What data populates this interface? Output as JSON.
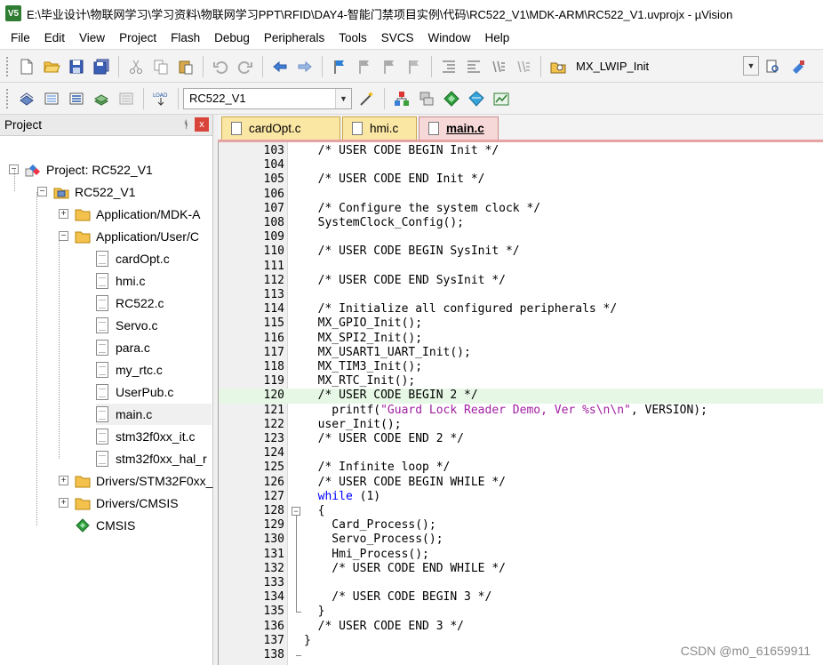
{
  "window": {
    "app_icon": "V5",
    "title": "E:\\毕业设计\\物联网学习\\学习资料\\物联网学习PPT\\RFID\\DAY4-智能门禁项目实例\\代码\\RC522_V1\\MDK-ARM\\RC522_V1.uvprojx - µVision"
  },
  "menu": [
    "File",
    "Edit",
    "View",
    "Project",
    "Flash",
    "Debug",
    "Peripherals",
    "Tools",
    "SVCS",
    "Window",
    "Help"
  ],
  "toolbar1": {
    "target_label": "MX_LWIP_Init"
  },
  "toolbar2": {
    "target_select": "RC522_V1"
  },
  "project_panel": {
    "title": "Project",
    "pin": "ᚬ",
    "close": "x",
    "tree": [
      {
        "label": "Project: RC522_V1",
        "icon": "project-icon",
        "level": 0,
        "expander": "−"
      },
      {
        "label": "RC522_V1",
        "icon": "target-icon",
        "level": 1,
        "expander": "−"
      },
      {
        "label": "Application/MDK-A",
        "icon": "folder-icon",
        "level": 2,
        "expander": "+"
      },
      {
        "label": "Application/User/C",
        "icon": "folder-icon",
        "level": 2,
        "expander": "−"
      },
      {
        "label": "cardOpt.c",
        "icon": "file-icon",
        "level": 3,
        "expander": ""
      },
      {
        "label": "hmi.c",
        "icon": "file-icon",
        "level": 3,
        "expander": ""
      },
      {
        "label": "RC522.c",
        "icon": "file-icon",
        "level": 3,
        "expander": ""
      },
      {
        "label": "Servo.c",
        "icon": "file-icon",
        "level": 3,
        "expander": ""
      },
      {
        "label": "para.c",
        "icon": "file-icon",
        "level": 3,
        "expander": ""
      },
      {
        "label": "my_rtc.c",
        "icon": "file-icon",
        "level": 3,
        "expander": ""
      },
      {
        "label": "UserPub.c",
        "icon": "file-icon",
        "level": 3,
        "expander": ""
      },
      {
        "label": "main.c",
        "icon": "file-icon",
        "level": 3,
        "expander": "",
        "selected": true
      },
      {
        "label": "stm32f0xx_it.c",
        "icon": "file-icon",
        "level": 3,
        "expander": ""
      },
      {
        "label": "stm32f0xx_hal_r",
        "icon": "file-icon",
        "level": 3,
        "expander": ""
      },
      {
        "label": "Drivers/STM32F0xx_",
        "icon": "folder-icon",
        "level": 2,
        "expander": "+"
      },
      {
        "label": "Drivers/CMSIS",
        "icon": "folder-icon",
        "level": 2,
        "expander": "+"
      },
      {
        "label": "CMSIS",
        "icon": "cmsis-icon",
        "level": 2,
        "expander": ""
      }
    ]
  },
  "tabs": [
    {
      "label": "cardOpt.c",
      "active": false
    },
    {
      "label": "hmi.c",
      "active": false
    },
    {
      "label": "main.c",
      "active": true
    }
  ],
  "editor": {
    "current_line": 120,
    "lines": [
      {
        "n": "103",
        "text": "  /* USER CODE BEGIN Init */",
        "kind": "comment"
      },
      {
        "n": "104",
        "text": "",
        "kind": "plain"
      },
      {
        "n": "105",
        "text": "  /* USER CODE END Init */",
        "kind": "comment"
      },
      {
        "n": "106",
        "text": "",
        "kind": "plain"
      },
      {
        "n": "107",
        "text": "  /* Configure the system clock */",
        "kind": "comment"
      },
      {
        "n": "108",
        "text": "  SystemClock_Config();",
        "kind": "plain"
      },
      {
        "n": "109",
        "text": "",
        "kind": "plain"
      },
      {
        "n": "110",
        "text": "  /* USER CODE BEGIN SysInit */",
        "kind": "comment"
      },
      {
        "n": "111",
        "text": "",
        "kind": "plain"
      },
      {
        "n": "112",
        "text": "  /* USER CODE END SysInit */",
        "kind": "comment"
      },
      {
        "n": "113",
        "text": "",
        "kind": "plain"
      },
      {
        "n": "114",
        "text": "  /* Initialize all configured peripherals */",
        "kind": "comment"
      },
      {
        "n": "115",
        "text": "  MX_GPIO_Init();",
        "kind": "plain"
      },
      {
        "n": "116",
        "text": "  MX_SPI2_Init();",
        "kind": "plain"
      },
      {
        "n": "117",
        "text": "  MX_USART1_UART_Init();",
        "kind": "plain"
      },
      {
        "n": "118",
        "text": "  MX_TIM3_Init();",
        "kind": "plain"
      },
      {
        "n": "119",
        "text": "  MX_RTC_Init();",
        "kind": "plain"
      },
      {
        "n": "120",
        "text": "  /* USER CODE BEGIN 2 */",
        "kind": "comment"
      },
      {
        "n": "121",
        "text": "    printf(",
        "kind": "printf",
        "str": "\"Guard Lock Reader Demo, Ver %s\\n\\n\"",
        "tail": ", VERSION);"
      },
      {
        "n": "122",
        "text": "  user_Init();",
        "kind": "plain"
      },
      {
        "n": "123",
        "text": "  /* USER CODE END 2 */",
        "kind": "comment"
      },
      {
        "n": "124",
        "text": "",
        "kind": "plain"
      },
      {
        "n": "125",
        "text": "  /* Infinite loop */",
        "kind": "comment"
      },
      {
        "n": "126",
        "text": "  /* USER CODE BEGIN WHILE */",
        "kind": "comment"
      },
      {
        "n": "127",
        "text": "  while",
        "kind": "while",
        "tail": " (1)"
      },
      {
        "n": "128",
        "text": "  {",
        "kind": "plain"
      },
      {
        "n": "129",
        "text": "    Card_Process();",
        "kind": "plain"
      },
      {
        "n": "130",
        "text": "    Servo_Process();",
        "kind": "plain"
      },
      {
        "n": "131",
        "text": "    Hmi_Process();",
        "kind": "plain"
      },
      {
        "n": "132",
        "text": "    /* USER CODE END WHILE */",
        "kind": "comment"
      },
      {
        "n": "133",
        "text": "",
        "kind": "plain"
      },
      {
        "n": "134",
        "text": "    /* USER CODE BEGIN 3 */",
        "kind": "comment"
      },
      {
        "n": "135",
        "text": "  }",
        "kind": "plain"
      },
      {
        "n": "136",
        "text": "  /* USER CODE END 3 */",
        "kind": "comment"
      },
      {
        "n": "137",
        "text": "}",
        "kind": "plain"
      },
      {
        "n": "138",
        "text": "",
        "kind": "plain"
      }
    ]
  },
  "watermark": "CSDN @m0_61659911",
  "colors": {
    "comment": "#0c0cd6",
    "keyword": "#0000ff",
    "string": "#a020a0",
    "current_line_bg": "#e6f7e6"
  }
}
